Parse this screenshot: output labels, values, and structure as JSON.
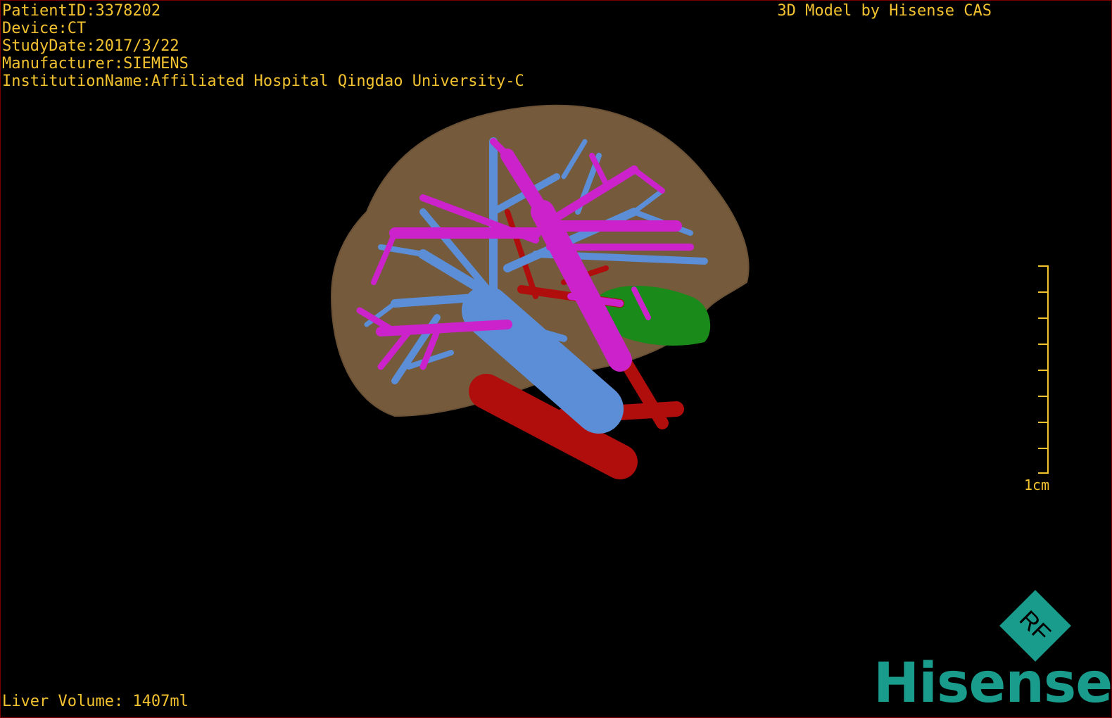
{
  "colors": {
    "text": "#f2c230",
    "scale": "#f2c230",
    "brand": "#1a9c8c",
    "liver": "#8a6a45",
    "portal_vein": "#cc22cc",
    "hepatic_vein": "#5b8ed6",
    "artery": "#b00d0d",
    "gallbladder": "#1a8a1a"
  },
  "info": {
    "patient_id": "PatientID:3378202",
    "device": "Device:CT",
    "study_date": "StudyDate:2017/3/22",
    "manufacturer": "Manufacturer:SIEMENS",
    "institution": "InstitutionName:Affiliated Hospital Qingdao University-C"
  },
  "title": "3D Model by Hisense CAS",
  "volume_text": "Liver Volume: 1407ml",
  "scale": {
    "label": "1cm"
  },
  "logo": {
    "mark_text": "RF",
    "brand_name": "Hisense"
  }
}
